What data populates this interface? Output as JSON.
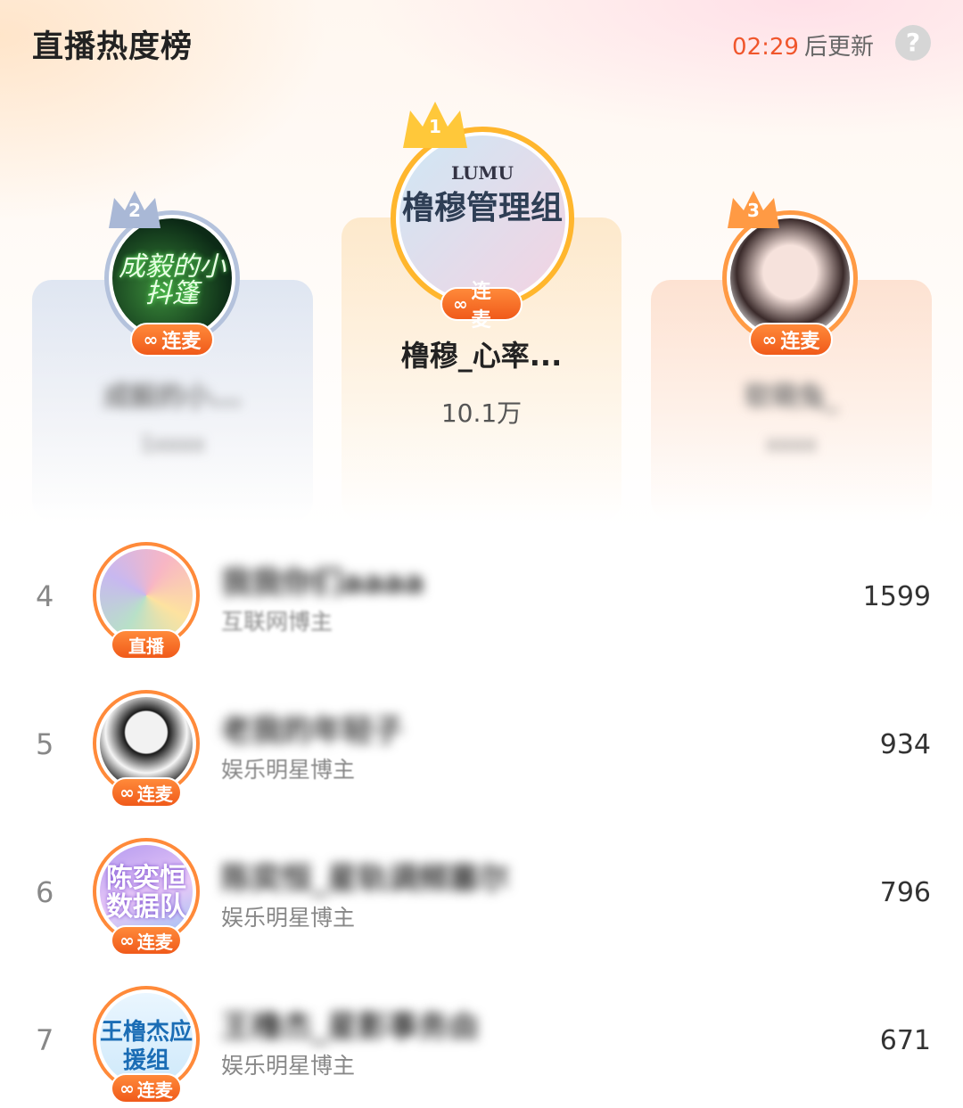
{
  "header": {
    "title": "直播热度榜",
    "countdown": "02:29",
    "update_suffix": "后更新",
    "help_label": "?"
  },
  "podium": [
    {
      "rank": "2",
      "name": "成毅的小...",
      "value": "1xxxx",
      "badge": "连麦",
      "avatar_text": "成毅的小抖篷",
      "ring_color": "#b4c2dc"
    },
    {
      "rank": "1",
      "name": "橹穆_心率...",
      "value": "10.1万",
      "badge": "连麦",
      "avatar_brand": "LUMU",
      "avatar_text": "橹穆管理组",
      "ring_color": "#ffb62d"
    },
    {
      "rank": "3",
      "name": "软萌兔_",
      "value": "xxxx",
      "badge": "连麦",
      "ring_color": "#ff9a44"
    }
  ],
  "list": [
    {
      "rank": "4",
      "name": "我我你们aaaa",
      "type": "互联网博主",
      "value": "1599",
      "badge": "直播"
    },
    {
      "rank": "5",
      "name": "老我的年轻子",
      "type": "娱乐明星博主",
      "value": "934",
      "badge": "连麦"
    },
    {
      "rank": "6",
      "name": "陈奕恒_星轨调频塞尔",
      "type": "娱乐明星博主",
      "value": "796",
      "badge": "连麦",
      "avatar_text": "陈奕恒数据队"
    },
    {
      "rank": "7",
      "name": "王橹杰_星影事务由",
      "type": "娱乐明星博主",
      "value": "671",
      "badge": "连麦",
      "avatar_text": "王橹杰应援组"
    }
  ],
  "colors": {
    "accent": "#f0562c",
    "badge_orange": "#ff8a3a",
    "gold": "#ffb62d",
    "silver": "#b4c2dc",
    "bronze": "#ff9a44"
  }
}
